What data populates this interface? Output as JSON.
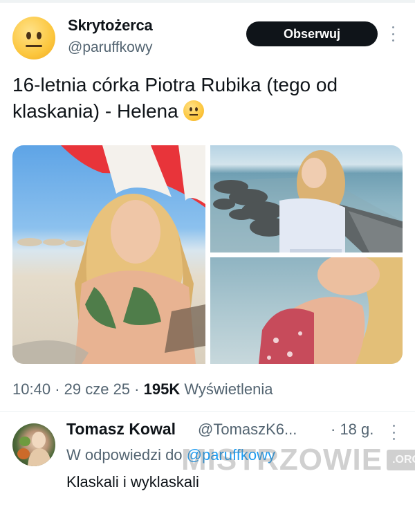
{
  "author": {
    "name": "Skrytożerca",
    "handle": "@paruffkowy",
    "avatar_icon": "neutral-face-emoji-icon"
  },
  "follow_label": "Obserwuj",
  "tweet": {
    "text": "16-letnia córka Piotra Rubika (tego od klaskania) - Helena",
    "trailing_emoji": "neutral-face-emoji-icon"
  },
  "media": {
    "count": 3
  },
  "meta": {
    "time": "10:40",
    "sep1": "·",
    "date": "29 cze 25",
    "sep2": "·",
    "views_count": "195K",
    "views_label": "Wyświetlenia"
  },
  "reply": {
    "name": "Tomasz Kowal",
    "handle": "@TomaszK6...",
    "time": "· 18 g.",
    "in_reply_prefix": "W odpowiedzi do",
    "in_reply_mention": "@paruffkowy",
    "text": "Klaskali i wyklaskali"
  },
  "watermark": {
    "main": "MISTRZOWIE",
    "tld": ".ORG"
  },
  "colors": {
    "text_primary": "#0f1419",
    "text_secondary": "#536471",
    "link": "#1d9bf0",
    "button_bg": "#0f1419"
  }
}
